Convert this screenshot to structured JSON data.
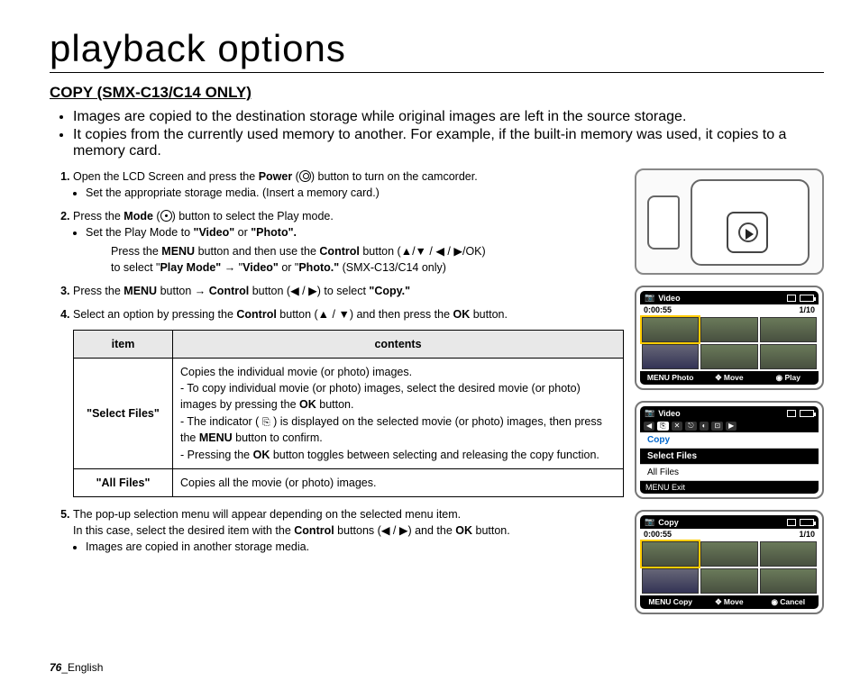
{
  "title": "playback options",
  "section": "COPY (SMX-C13/C14 ONLY)",
  "intro": [
    "Images are copied to the destination storage while original images are left in the source storage.",
    "It copies from the currently used memory to another. For example, if the built-in memory was used, it copies to a memory card."
  ],
  "steps": {
    "s1": {
      "lead": "Open the LCD Screen and press the ",
      "b1": "Power",
      "tail": " button to turn on the camcorder.",
      "sub": "Set the appropriate storage media. (Insert a memory card.)"
    },
    "s2": {
      "lead": "Press the ",
      "b1": "Mode",
      "tail": " button to select the Play mode.",
      "sub_lead": "Set the Play Mode to ",
      "video": "\"Video\"",
      "or": " or ",
      "photo": "\"Photo\".",
      "line2a": "Press the ",
      "menu": "MENU",
      "line2b": " button and then use the ",
      "ctrl": "Control",
      "line2c": " button (▲/▼ / ◀ / ▶/OK)",
      "line3a": "to select \"",
      "pm": "Play Mode\"",
      "arrow": " → \"",
      "vid2": "Video\"",
      "or2": " or \"",
      "ph2": "Photo.\"",
      "note": " (SMX-C13/C14 only)"
    },
    "s3": {
      "a": "Press the ",
      "menu": "MENU",
      "b": " button → ",
      "ctrl": "Control",
      "c": " button (◀ / ▶) to select ",
      "copy": "\"Copy.\""
    },
    "s4": {
      "a": "Select an option by pressing the ",
      "ctrl": "Control",
      "b": " button (▲ / ▼) and then press the ",
      "ok": "OK",
      "c": " button."
    },
    "s5": {
      "a": "The pop-up selection menu will appear depending on the selected menu item.",
      "b_lead": "In this case, select the desired item with the ",
      "ctrl": "Control",
      "b_mid": " buttons (◀ / ▶) and the ",
      "ok": "OK",
      "b_tail": " button.",
      "sub": "Images are copied in another storage media."
    }
  },
  "table": {
    "h_item": "item",
    "h_contents": "contents",
    "r1_item": "\"Select Files\"",
    "r1_l1": "Copies the individual movie (or photo) images.",
    "r1_l2a": "To copy individual movie (or photo) images, select the desired movie (or photo) images by pressing the ",
    "r1_ok": "OK",
    "r1_l2b": " button.",
    "r1_l3a": "The indicator (",
    "r1_l3b": ") is displayed on the selected movie (or photo) images, then press the ",
    "r1_menu": "MENU",
    "r1_l3c": " button to confirm.",
    "r1_l4a": "Pressing the ",
    "r1_ok2": "OK",
    "r1_l4b": " button toggles between selecting and releasing the copy function.",
    "r2_item": "\"All Files\"",
    "r2_c": "Copies all the movie (or photo) images."
  },
  "lcd1": {
    "title": "Video",
    "time": "0:00:55",
    "count": "1/10",
    "left": "MENU Photo",
    "mid": "Move",
    "right": "Play"
  },
  "lcd2": {
    "title": "Video",
    "copy": "Copy",
    "sel": "Select Files",
    "all": "All Files",
    "exit": "MENU Exit"
  },
  "lcd3": {
    "title": "Copy",
    "time": "0:00:55",
    "count": "1/10",
    "left": "MENU Copy",
    "mid": "Move",
    "right": "Cancel"
  },
  "footer": {
    "page": "76",
    "lang": "_English"
  }
}
